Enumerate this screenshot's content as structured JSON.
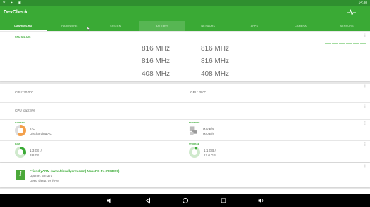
{
  "statusbar": {
    "left_icons": "⚲ ⌖ ▣",
    "time": "14:38"
  },
  "app": {
    "title": "DevCheck",
    "more": "⋮"
  },
  "tabs": [
    {
      "label": "DASHBOARD"
    },
    {
      "label": "HARDWARE"
    },
    {
      "label": "SYSTEM"
    },
    {
      "label": "BATTERY"
    },
    {
      "label": "NETWORK"
    },
    {
      "label": "APPS"
    },
    {
      "label": "CAMERA"
    },
    {
      "label": "SENSORS"
    }
  ],
  "cpu": {
    "label": "CPU STATUS",
    "freqs": [
      "816 MHz",
      "816 MHz",
      "816 MHz",
      "816 MHz",
      "408 MHz",
      "408 MHz"
    ]
  },
  "temps": {
    "cpu": "CPU: 30.0°C",
    "gpu": "GPU: 30°C"
  },
  "load": {
    "cpu_load": "CPU load: 8%"
  },
  "battery": {
    "label": "BATTERY",
    "temp": "2°C",
    "status": "Discharging AC"
  },
  "network": {
    "label": "NETWORK",
    "tx": "tx 0 B/s",
    "rx": "rx 0 B/s"
  },
  "ram": {
    "label": "RAM",
    "used": "1.3 GB /",
    "total": "3.8 GB"
  },
  "storage": {
    "label": "STORAGE",
    "used": "1.1 GB /",
    "total": "12.0 GB"
  },
  "device": {
    "name": "FriendlyARM (www.friendlyarm.com) NanoPC-T4 (RK3399)",
    "uptime": "Uptime: 5m 37s",
    "deep_sleep": "Deep sleep: 0s (0%)",
    "icon_letter": "i"
  },
  "colors": {
    "primary": "#3aaa35",
    "primary_dark": "#2f8f2f"
  }
}
